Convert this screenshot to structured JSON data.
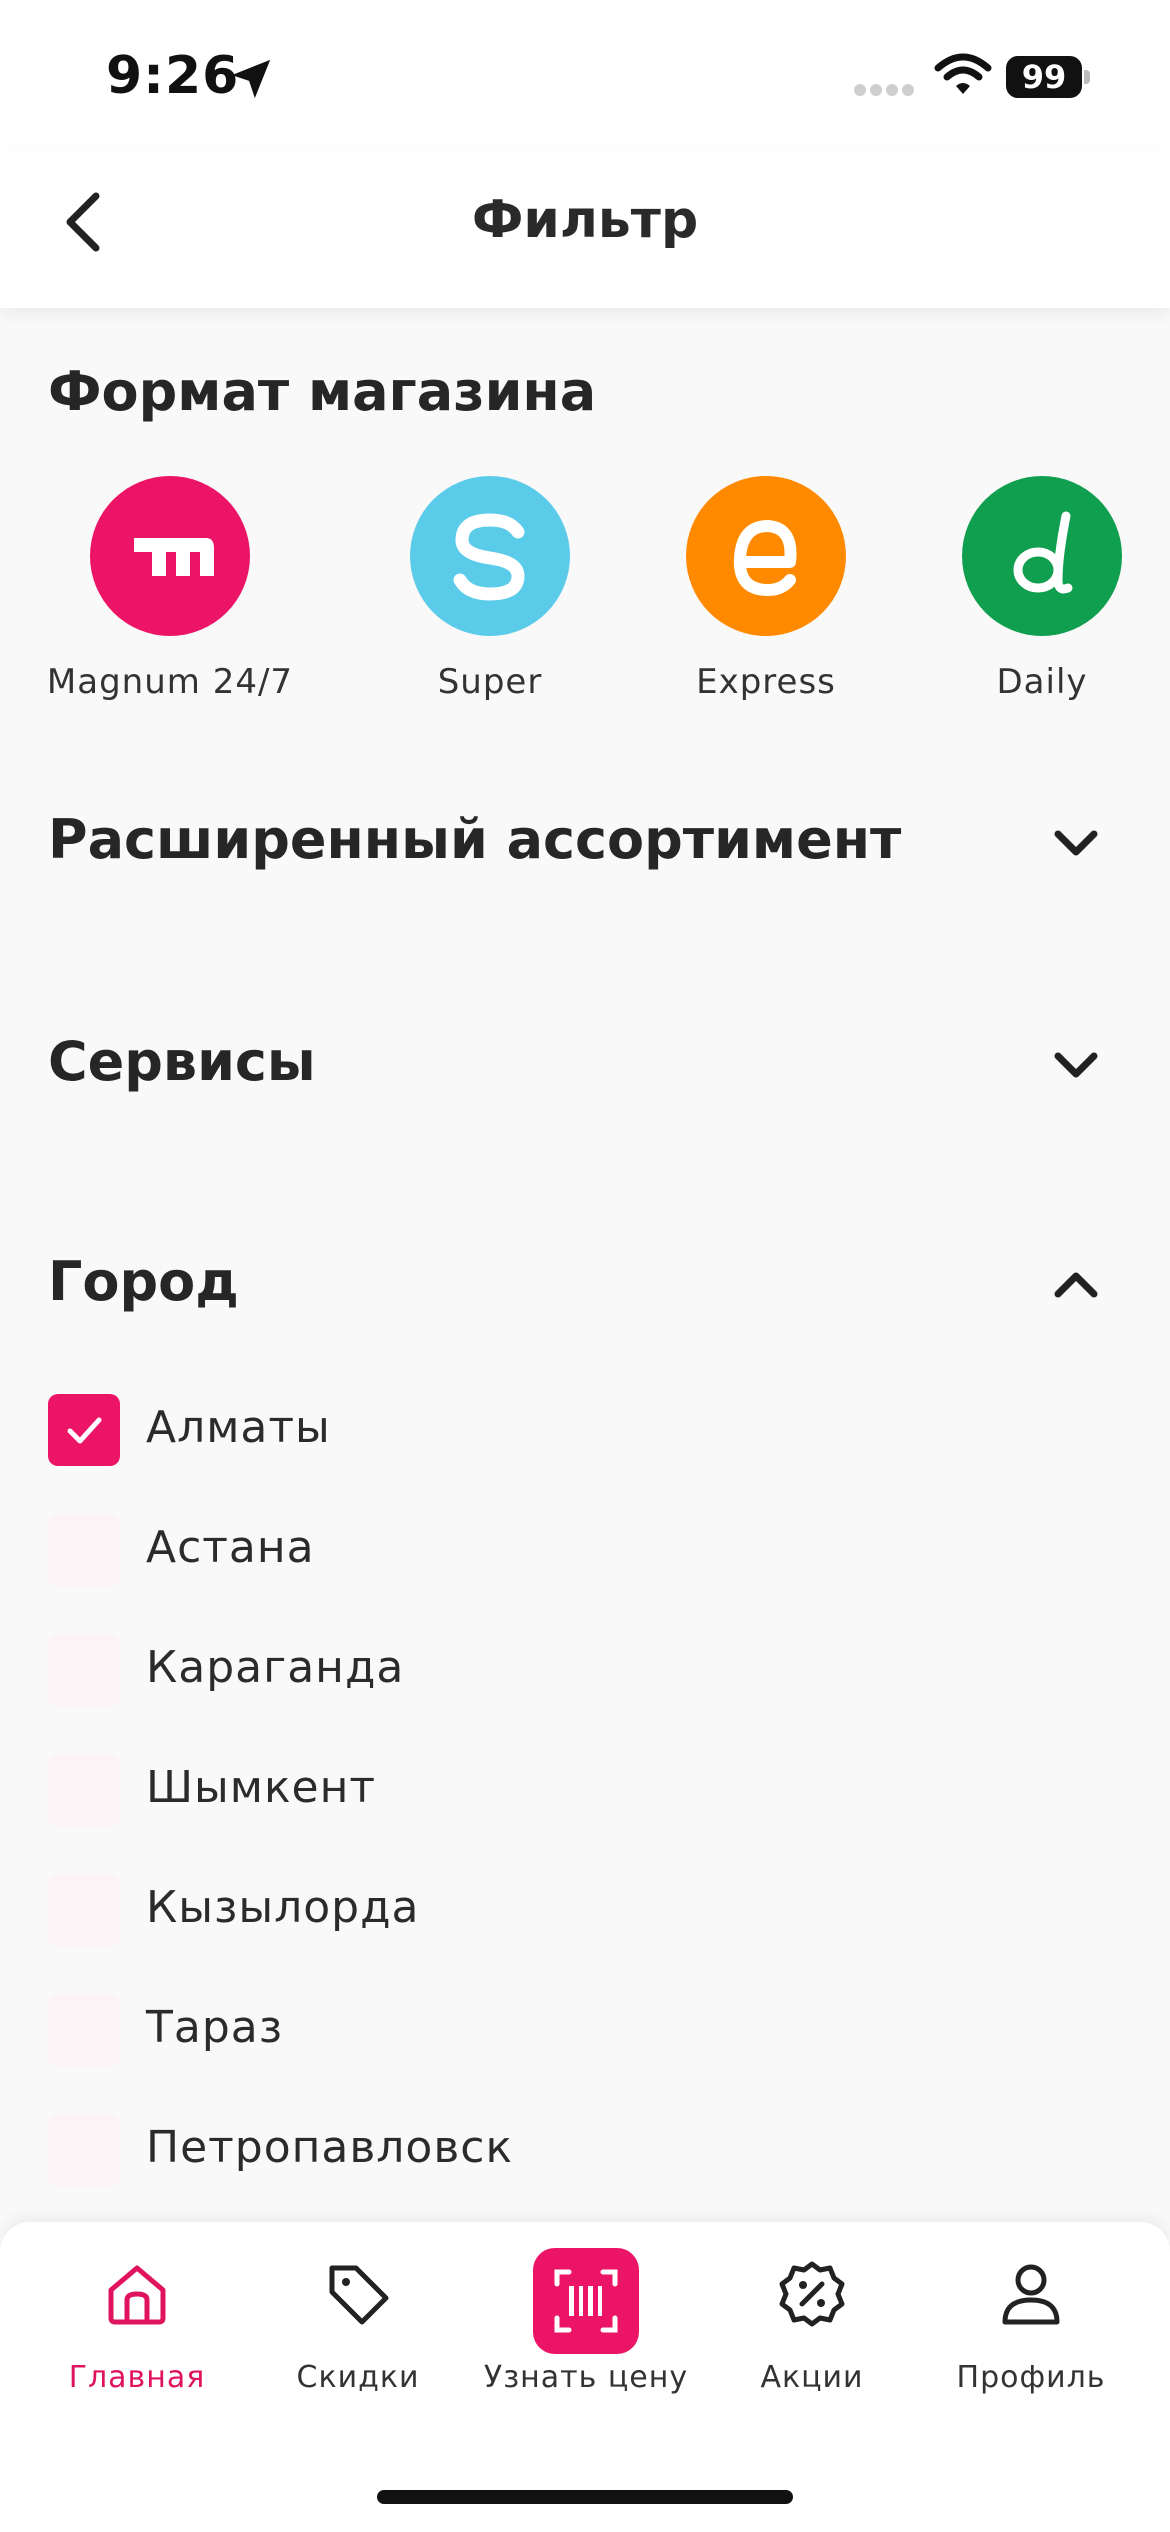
{
  "status_bar": {
    "time": "9:26",
    "battery": "99"
  },
  "header": {
    "title": "Фильтр"
  },
  "store_format": {
    "title": "Формат магазина",
    "items": [
      {
        "label": "Magnum 24/7",
        "color": "#EC1466",
        "icon": "magnum-logo-icon"
      },
      {
        "label": "Super",
        "color": "#5BCBEA",
        "icon": "super-logo-icon"
      },
      {
        "label": "Express",
        "color": "#FF8A00",
        "icon": "express-logo-icon"
      },
      {
        "label": "Daily",
        "color": "#0F9F4E",
        "icon": "daily-logo-icon"
      }
    ]
  },
  "sections": {
    "assortment": {
      "title": "Расширенный ассортимент",
      "expanded": false
    },
    "services": {
      "title": "Сервисы",
      "expanded": false
    },
    "city": {
      "title": "Город",
      "expanded": true
    }
  },
  "cities": [
    {
      "label": "Алматы",
      "checked": true
    },
    {
      "label": "Астана",
      "checked": false
    },
    {
      "label": "Караганда",
      "checked": false
    },
    {
      "label": "Шымкент",
      "checked": false
    },
    {
      "label": "Кызылорда",
      "checked": false
    },
    {
      "label": "Тараз",
      "checked": false
    },
    {
      "label": "Петропавловск",
      "checked": false
    }
  ],
  "tab_bar": {
    "items": [
      {
        "label": "Главная",
        "icon": "home-icon",
        "active": true
      },
      {
        "label": "Скидки",
        "icon": "tag-icon",
        "active": false
      },
      {
        "label": "Узнать цену",
        "icon": "barcode-scan-icon",
        "active": false
      },
      {
        "label": "Акции",
        "icon": "percent-badge-icon",
        "active": false
      },
      {
        "label": "Профиль",
        "icon": "profile-icon",
        "active": false
      }
    ]
  },
  "colors": {
    "accent": "#EC1466",
    "background": "#F9F9FA",
    "checkbox_unchecked": "#FCF3F7"
  }
}
